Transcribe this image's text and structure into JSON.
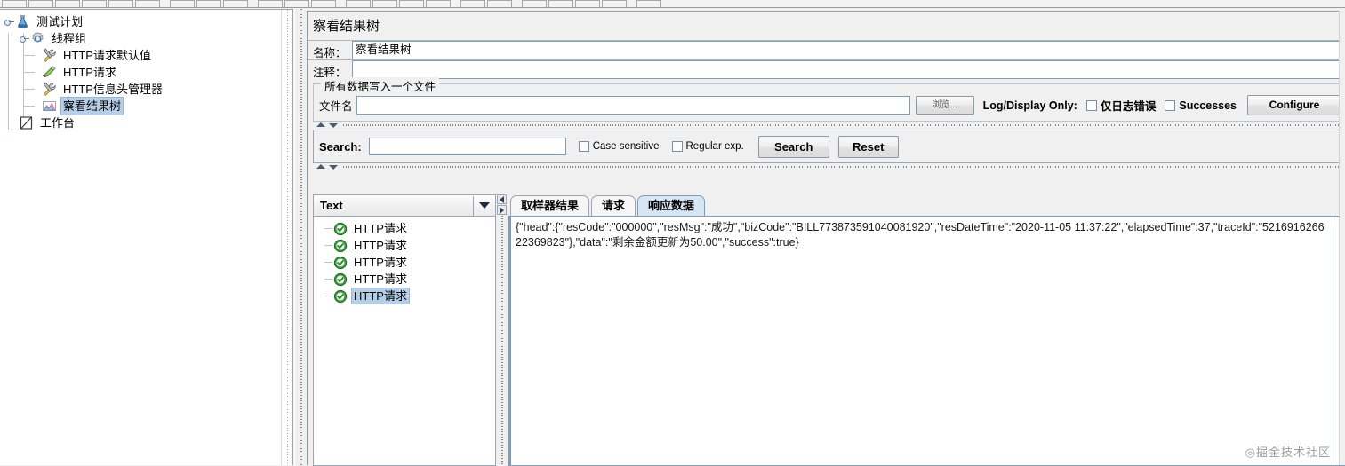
{
  "toolbar": {
    "buttons": [
      "new",
      "templates",
      "open",
      "save",
      "save-as",
      "cut",
      "copy",
      "paste",
      "expand",
      "collapse",
      "toggle",
      "start",
      "start-no-pause",
      "stop",
      "shutdown",
      "clear",
      "clear-all",
      "search",
      "search-reset",
      "undo",
      "redo",
      "help"
    ]
  },
  "tree": {
    "nodes": [
      {
        "label": "测试计划",
        "icon": "test-plan-icon",
        "depth": 0,
        "selected": false
      },
      {
        "label": "线程组",
        "icon": "thread-group-icon",
        "depth": 1,
        "selected": false
      },
      {
        "label": "HTTP请求默认值",
        "icon": "http-defaults-icon",
        "depth": 2,
        "selected": false
      },
      {
        "label": "HTTP请求",
        "icon": "http-sampler-icon",
        "depth": 2,
        "selected": false
      },
      {
        "label": "HTTP信息头管理器",
        "icon": "header-manager-icon",
        "depth": 2,
        "selected": false
      },
      {
        "label": "察看结果树",
        "icon": "view-results-tree-icon",
        "depth": 2,
        "selected": true
      },
      {
        "label": "工作台",
        "icon": "workbench-icon",
        "depth": 0,
        "selected": false
      }
    ]
  },
  "main": {
    "title": "察看结果树",
    "name_label": "名称：",
    "name_value": "察看结果树",
    "comment_label": "注释：",
    "comment_value": "",
    "file_group_title": "所有数据写入一个文件",
    "filename_label": "文件名",
    "filename_value": "",
    "filename_placeholder": "",
    "browse_label": "浏览...",
    "log_display_label": "Log/Display Only:",
    "errors_checkbox_label": "仅日志错误",
    "errors_checked": false,
    "successes_checkbox_label": "Successes",
    "successes_checked": false,
    "configure_label": "Configure"
  },
  "search": {
    "label": "Search:",
    "value": "",
    "placeholder": "",
    "case_sensitive_label": "Case sensitive",
    "case_sensitive_checked": false,
    "regex_label": "Regular exp.",
    "regex_checked": false,
    "search_button": "Search",
    "reset_button": "Reset"
  },
  "results": {
    "renderer_selected": "Text",
    "items": [
      {
        "label": "HTTP请求",
        "status": "success",
        "selected": false
      },
      {
        "label": "HTTP请求",
        "status": "success",
        "selected": false
      },
      {
        "label": "HTTP请求",
        "status": "success",
        "selected": false
      },
      {
        "label": "HTTP请求",
        "status": "success",
        "selected": false
      },
      {
        "label": "HTTP请求",
        "status": "success",
        "selected": true
      }
    ]
  },
  "tabs": [
    {
      "label": "取样器结果",
      "active": false
    },
    {
      "label": "请求",
      "active": false
    },
    {
      "label": "响应数据",
      "active": true
    }
  ],
  "response": {
    "body": "{\"head\":{\"resCode\":\"000000\",\"resMsg\":\"成功\",\"bizCode\":\"BILL773873591040081920\",\"resDateTime\":\"2020-11-05 11:37:22\",\"elapsedTime\":37,\"traceId\":\"521691626622369823\"},\"data\":\"剩余金额更新为50.00\",\"success\":true}"
  },
  "watermark": {
    "text": "◎掘金技术社区"
  },
  "colors": {
    "accent": "#b5cfe8",
    "success": "#37a737",
    "panel": "#f0f0f0",
    "border": "#9aa6b5",
    "active_tab": "#d6e6f5"
  }
}
